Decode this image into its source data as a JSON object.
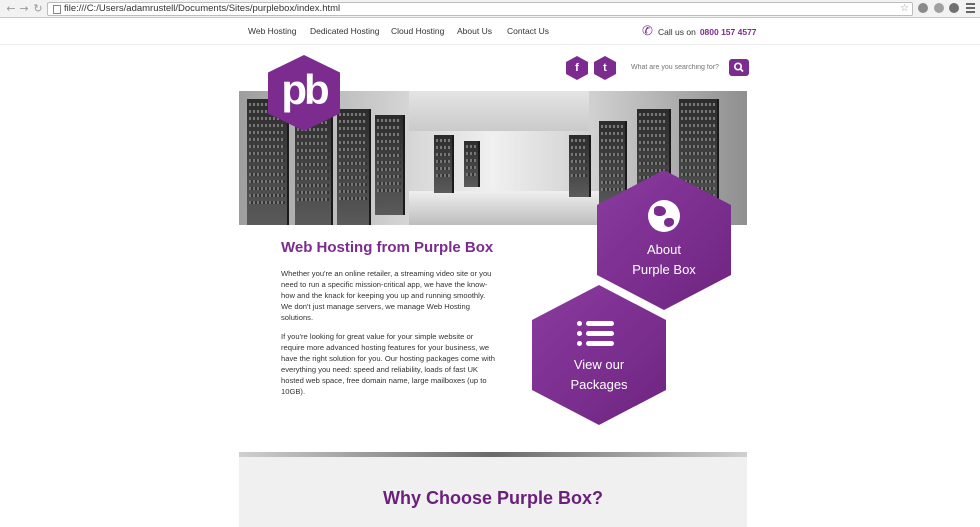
{
  "browser": {
    "url": "file:///C:/Users/adamrustell/Documents/Sites/purplebox/index.html",
    "back_icon": "back-arrow-icon",
    "forward_icon": "forward-arrow-icon",
    "reload_icon": "reload-icon",
    "back_glyph": "←",
    "forward_glyph": "→",
    "reload_glyph": "↻",
    "star_glyph": "☆"
  },
  "nav": {
    "items": [
      "Web Hosting",
      "Dedicated Hosting",
      "Cloud Hosting",
      "About Us",
      "Contact Us"
    ]
  },
  "call": {
    "label": "Call us on",
    "number": "0800 157 4577",
    "phone_glyph": "✆"
  },
  "social": {
    "facebook": "f",
    "twitter": "t"
  },
  "search": {
    "placeholder": "What are you searching for?"
  },
  "logo": {
    "text": "pb"
  },
  "intro": {
    "heading": "Web Hosting from Purple Box",
    "para1": "Whether you're an online retailer, a streaming video site or you need to run a specific mission-critical app, we have the know-how and the knack for keeping you up and running smoothly. We don't just manage servers, we manage Web Hosting solutions.",
    "para2": "If you're looking for great value for your simple website or require more advanced hosting features for your business, we have the right solution for you. Our hosting packages come with everything you need: speed and reliability, loads of fast UK hosted web space, free domain name, large mailboxes (up to 10GB)."
  },
  "cta": {
    "about_line1": "About",
    "about_line2": "Purple Box",
    "packages_line1": "View our",
    "packages_line2": "Packages"
  },
  "why": {
    "title": "Why Choose Purple Box?"
  },
  "colors": {
    "brand": "#7b2c8e"
  }
}
